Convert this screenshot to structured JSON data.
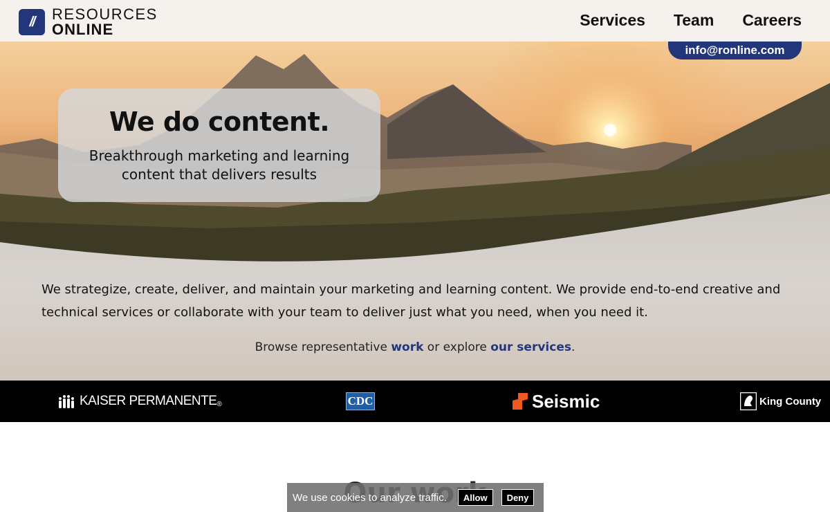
{
  "header": {
    "logo_line1": "RESOURCES",
    "logo_line2": "ONLINE",
    "logo_mark": "//",
    "nav": [
      {
        "label": "Services"
      },
      {
        "label": "Team"
      },
      {
        "label": "Careers"
      }
    ],
    "email": "info@ronline.com"
  },
  "hero": {
    "title": "We do content.",
    "subtitle": "Breakthrough marketing and learning content that delivers results",
    "intro": "We strategize, create, deliver, and maintain your marketing and learning content. We provide end-to-end creative and technical services or collaborate with your team to deliver just what you need, when you need it.",
    "browse_prefix": "Browse representative ",
    "browse_work": "work",
    "browse_middle": " or explore ",
    "browse_services": "our services",
    "browse_suffix": "."
  },
  "clients": {
    "kaiser": "KAISER PERMANENTE",
    "kaiser_mark": "®",
    "cdc": "CDC",
    "seismic": "Seismic",
    "king_county": "King County"
  },
  "section": {
    "title": "Our work"
  },
  "cookie": {
    "text": "We use cookies to analyze traffic.",
    "allow": "Allow",
    "deny": "Deny"
  },
  "colors": {
    "brand": "#24367a",
    "header_bg": "#f5f1ec",
    "strip_bg": "#000000",
    "seismic_accent": "#f05a22"
  }
}
